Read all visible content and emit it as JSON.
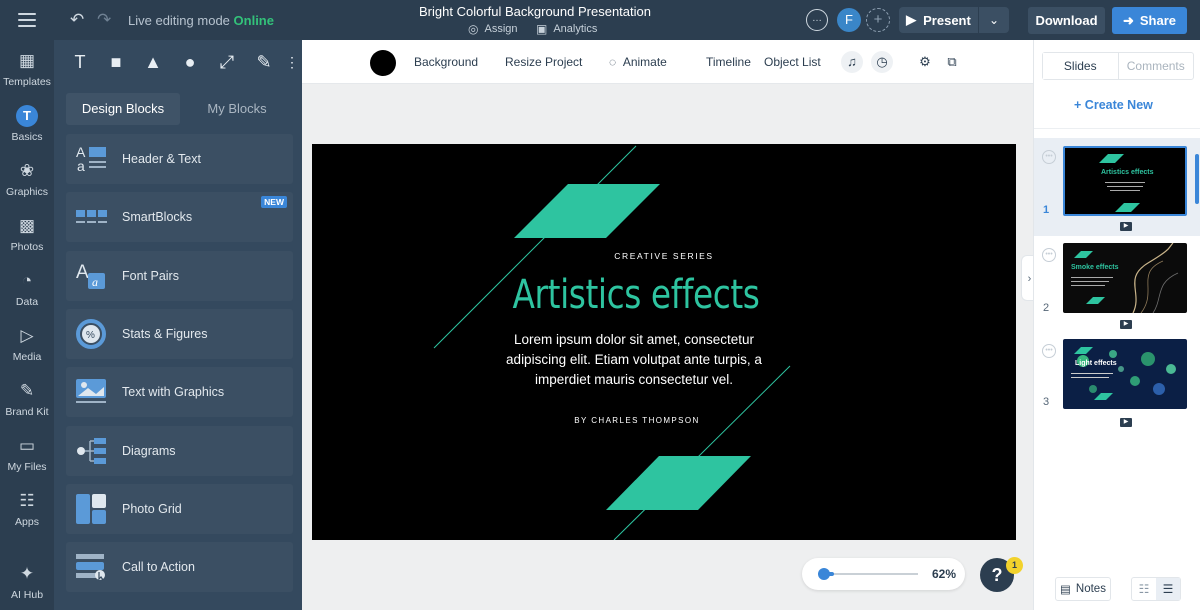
{
  "topbar": {
    "mode_label": "Live editing mode",
    "mode_status": "Online",
    "title": "Bright Colorful Background Presentation",
    "assign": "Assign",
    "analytics": "Analytics",
    "avatar_initial": "F",
    "present": "Present",
    "download": "Download",
    "share": "Share"
  },
  "leftnav": {
    "items": [
      {
        "label": "Templates",
        "icon": "templates-icon"
      },
      {
        "label": "Basics",
        "icon": "basics-icon"
      },
      {
        "label": "Graphics",
        "icon": "graphics-icon"
      },
      {
        "label": "Photos",
        "icon": "photos-icon"
      },
      {
        "label": "Data",
        "icon": "data-icon"
      },
      {
        "label": "Media",
        "icon": "media-icon"
      },
      {
        "label": "Brand Kit",
        "icon": "brand-kit-icon"
      },
      {
        "label": "My Files",
        "icon": "folder-icon"
      },
      {
        "label": "Apps",
        "icon": "apps-icon"
      },
      {
        "label": "AI Hub",
        "icon": "ai-hub-icon"
      }
    ],
    "active": "Basics"
  },
  "panel": {
    "tabs": [
      "Design Blocks",
      "My Blocks"
    ],
    "active_tab": "Design Blocks",
    "blocks": [
      {
        "label": "Header & Text"
      },
      {
        "label": "SmartBlocks",
        "badge": "NEW"
      },
      {
        "label": "Font Pairs"
      },
      {
        "label": "Stats & Figures"
      },
      {
        "label": "Text with Graphics"
      },
      {
        "label": "Diagrams"
      },
      {
        "label": "Photo Grid"
      },
      {
        "label": "Call to Action"
      }
    ]
  },
  "toolbar": {
    "background": "Background",
    "resize": "Resize Project",
    "animate": "Animate",
    "timeline": "Timeline",
    "object_list": "Object List",
    "background_color": "#000000"
  },
  "slide": {
    "eyebrow": "CREATIVE SERIES",
    "title": "Artistics effects",
    "body": "Lorem ipsum dolor sit amet, consectetur adipiscing elit. Etiam volutpat ante turpis, a imperdiet mauris consectetur vel.",
    "byline": "BY CHARLES THOMPSON",
    "accent_color": "#2ec4a0"
  },
  "zoom": {
    "level": "62%",
    "slider_fraction": 0.0
  },
  "help": {
    "symbol": "?",
    "badge": "1"
  },
  "rightpanel": {
    "tabs": [
      "Slides",
      "Comments"
    ],
    "active_tab": "Slides",
    "create_new": "Create New",
    "slides": [
      {
        "number": "1",
        "title": "Artistics effects"
      },
      {
        "number": "2",
        "title": "Smoke effects"
      },
      {
        "number": "3",
        "title": "Light effects"
      }
    ],
    "notes": "Notes"
  }
}
